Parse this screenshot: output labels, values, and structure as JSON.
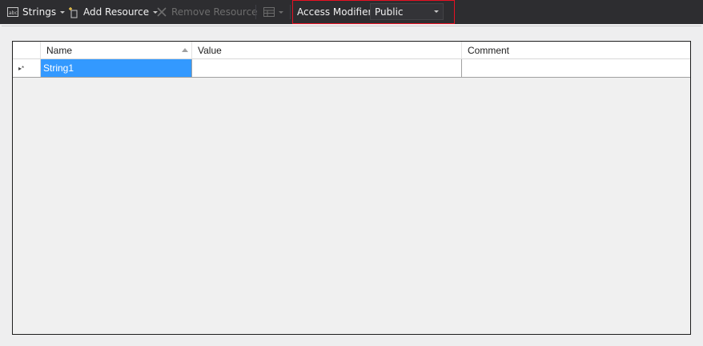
{
  "toolbar": {
    "strings_label": "Strings",
    "add_resource_label": "Add Resource",
    "remove_resource_label": "Remove Resource",
    "access_modifier_label": "Access Modifier:",
    "access_modifier_value": "Public"
  },
  "grid": {
    "columns": [
      "Name",
      "Value",
      "Comment"
    ],
    "row_indicator": "▸*",
    "rows": [
      {
        "name": "String1",
        "value": "",
        "comment": ""
      }
    ]
  },
  "colors": {
    "toolbar_bg": "#2d2d30",
    "highlight_border": "#e81123",
    "selection": "#3399ff"
  }
}
